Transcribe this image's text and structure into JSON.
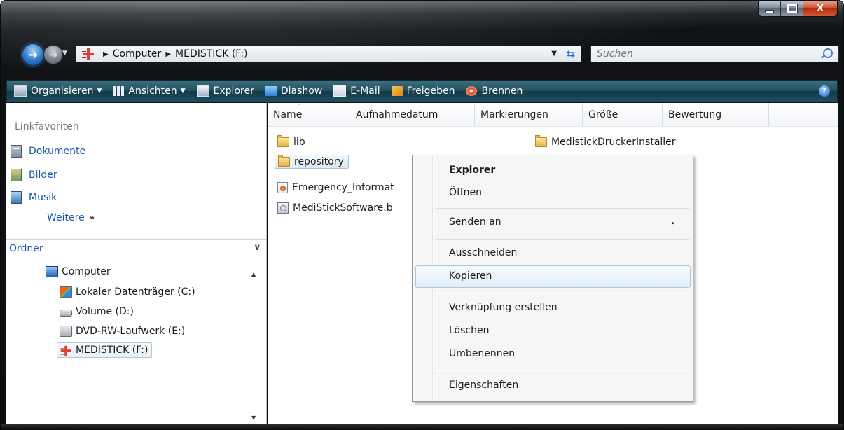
{
  "window": {
    "caption_buttons": {
      "close_label": "X"
    }
  },
  "nav": {
    "path": [
      "Computer",
      "MEDISTICK (F:)"
    ]
  },
  "search": {
    "placeholder": "Suchen"
  },
  "toolbar": {
    "items": [
      {
        "label": "Organisieren",
        "icon": "organize-icon",
        "has_dropdown": true
      },
      {
        "label": "Ansichten",
        "icon": "views-icon",
        "has_dropdown": true
      },
      {
        "label": "Explorer",
        "icon": "explorer-icon"
      },
      {
        "label": "Diashow",
        "icon": "slideshow-icon"
      },
      {
        "label": "E-Mail",
        "icon": "email-icon"
      },
      {
        "label": "Freigeben",
        "icon": "share-icon"
      },
      {
        "label": "Brennen",
        "icon": "burn-icon"
      }
    ],
    "help": "?"
  },
  "sidebar": {
    "favorites_title": "Linkfavoriten",
    "favorites": [
      {
        "label": "Dokumente",
        "icon": "documents-icon"
      },
      {
        "label": "Bilder",
        "icon": "pictures-icon"
      },
      {
        "label": "Musik",
        "icon": "music-icon"
      }
    ],
    "more_label": "Weitere",
    "more_glyph": "»",
    "folders_title": "Ordner",
    "tree": [
      {
        "label": "Computer",
        "icon": "computer-icon"
      },
      {
        "label": "Lokaler Datenträger (C:)",
        "icon": "windows-drive-icon"
      },
      {
        "label": "Volume (D:)",
        "icon": "hard-drive-icon"
      },
      {
        "label": "DVD-RW-Laufwerk (E:)",
        "icon": "dvd-drive-icon"
      },
      {
        "label": "MEDISTICK (F:)",
        "icon": "medistick-drive-icon",
        "selected": true
      }
    ]
  },
  "file_list": {
    "columns": [
      "Name",
      "Aufnahmedatum",
      "Markierungen",
      "Größe",
      "Bewertung"
    ],
    "sort_column": "Name",
    "files": [
      {
        "name": "lib",
        "type": "folder"
      },
      {
        "name": "repository",
        "type": "folder",
        "selected": true
      },
      {
        "name": "Emergency_Informat",
        "type": "html"
      },
      {
        "name": "MediStickSoftware.b",
        "type": "batch"
      },
      {
        "name": "MedistickDruckerInstaller",
        "type": "folder"
      }
    ]
  },
  "context_menu": {
    "items": [
      {
        "label": "Explorer",
        "bold": true
      },
      {
        "label": "Öffnen"
      },
      {
        "label": "Senden an",
        "submenu": true
      },
      {
        "label": "Ausschneiden"
      },
      {
        "label": "Kopieren",
        "highlighted": true
      },
      {
        "label": "Verknüpfung erstellen"
      },
      {
        "label": "Löschen"
      },
      {
        "label": "Umbenennen"
      },
      {
        "label": "Eigenschaften"
      }
    ],
    "submenu_glyph": "▸"
  },
  "colors": {
    "toolbar_bg": "#23505f",
    "link_blue": "#1a57a8",
    "selection_border": "#a9c8e2"
  }
}
